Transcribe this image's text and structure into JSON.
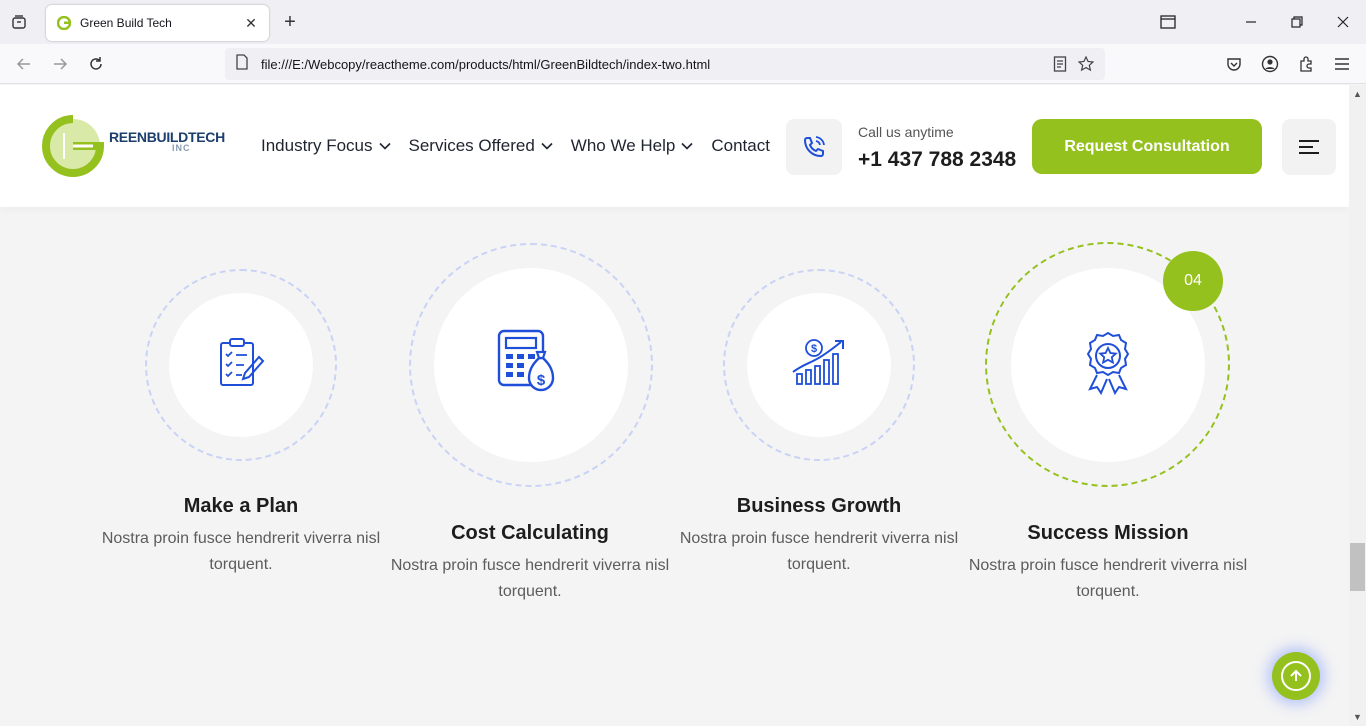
{
  "browser": {
    "tab_title": "Green Build Tech",
    "url": "file:///E:/Webcopy/reactheme.com/products/html/GreenBildtech/index-two.html"
  },
  "header": {
    "logo": {
      "brand_prefix": "G",
      "brand_reen": "REEN",
      "brand_rest": "BUILDTECH",
      "suffix": "INC"
    },
    "menu": [
      {
        "label": "Industry Focus",
        "has_dropdown": true
      },
      {
        "label": "Services Offered",
        "has_dropdown": true
      },
      {
        "label": "Who We Help",
        "has_dropdown": true
      },
      {
        "label": "Contact",
        "has_dropdown": false
      }
    ],
    "call_label": "Call us anytime",
    "call_number": "+1 437 788 2348",
    "cta_label": "Request Consultation"
  },
  "steps": [
    {
      "title": "Make a Plan",
      "desc": "Nostra proin fusce hendrerit viverra nisl torquent.",
      "icon": "clipboard-plan-icon"
    },
    {
      "title": "Cost Calculating",
      "desc": "Nostra proin fusce hendrerit viverra nisl torquent.",
      "icon": "calculator-money-icon"
    },
    {
      "title": "Business Growth",
      "desc": "Nostra proin fusce hendrerit viverra nisl torquent.",
      "icon": "growth-chart-icon"
    },
    {
      "title": "Success Mission",
      "desc": "Nostra proin fusce hendrerit viverra nisl torquent.",
      "icon": "award-badge-icon",
      "badge": "04"
    }
  ],
  "colors": {
    "brand_green": "#95c11f",
    "icon_blue": "#1f4fd8",
    "ring_blue": "#c9d3f5"
  }
}
